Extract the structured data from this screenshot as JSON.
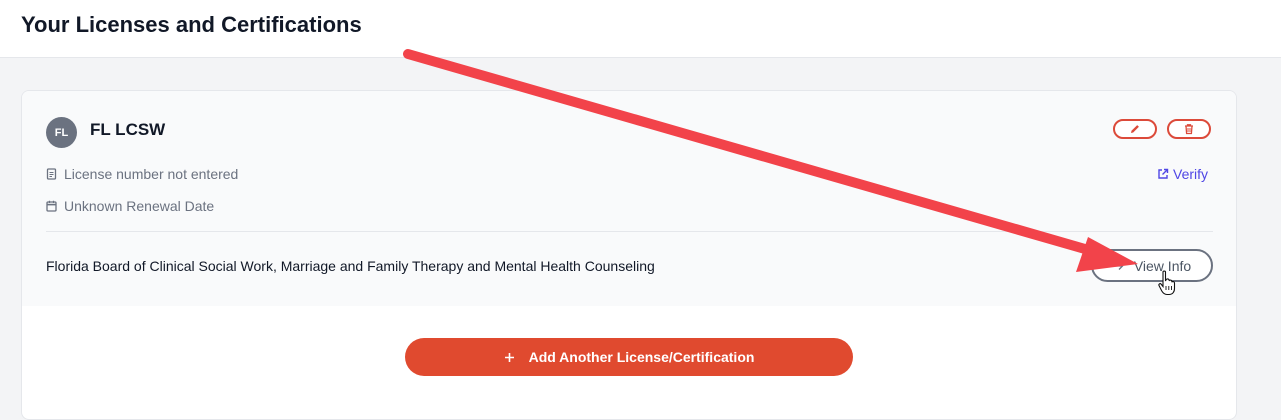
{
  "header": {
    "title": "Your Licenses and Certifications"
  },
  "license": {
    "avatar_initials": "FL",
    "name": "FL LCSW",
    "number_text": "License number not entered",
    "renewal_text": "Unknown Renewal Date",
    "verify_label": "Verify",
    "board_name": "Florida Board of Clinical Social Work, Marriage and Family Therapy and Mental Health Counseling",
    "view_info_label": "View Info"
  },
  "actions": {
    "add_label": "Add Another License/Certification"
  },
  "icons": {
    "edit": "pencil-icon",
    "delete": "trash-icon",
    "number": "clipboard-icon",
    "renewal": "calendar-icon",
    "verify": "external-link-icon",
    "view_info": "arrow-right-icon",
    "add": "plus-icon"
  },
  "colors": {
    "accent": "#e04a2f",
    "danger_outline": "#dc4a3a",
    "link": "#4f46e5",
    "annotation_arrow": "#f2434a"
  }
}
